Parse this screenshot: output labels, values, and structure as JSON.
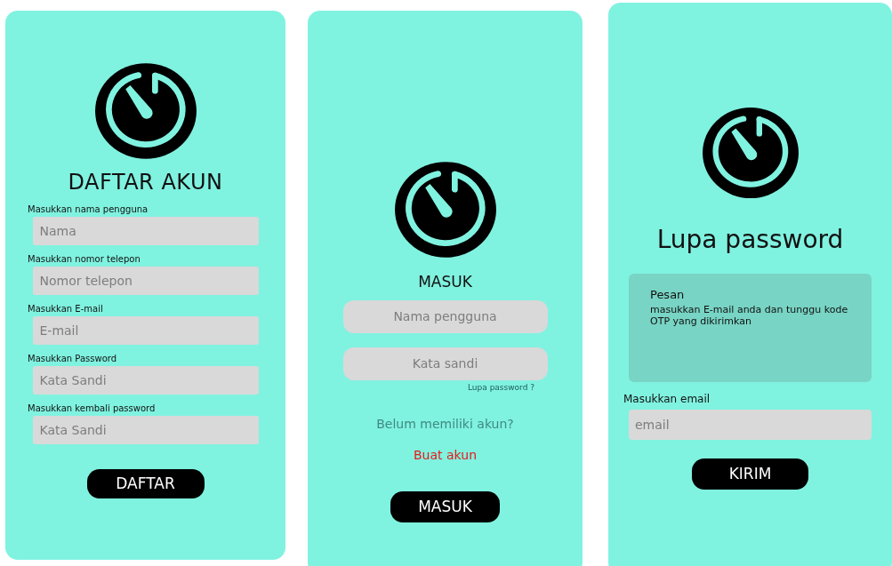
{
  "screens": [
    {
      "kind": "register",
      "items": [
        {
          "kind": "logo"
        },
        {
          "kind": "title",
          "text": "DAFTAR AKUN"
        },
        {
          "kind": "label",
          "text": "Masukkan nama pengguna"
        },
        {
          "kind": "field",
          "placeholder": "Nama"
        },
        {
          "kind": "label",
          "text": "Masukkan nomor telepon"
        },
        {
          "kind": "field",
          "placeholder": "Nomor telepon"
        },
        {
          "kind": "label",
          "text": "Masukkan E-mail"
        },
        {
          "kind": "field",
          "placeholder": "E-mail"
        },
        {
          "kind": "label",
          "text": "Masukkan Password"
        },
        {
          "kind": "field",
          "placeholder": "Kata Sandi"
        },
        {
          "kind": "label",
          "text": "Masukkan kembali password"
        },
        {
          "kind": "field",
          "placeholder": "Kata Sandi"
        },
        {
          "kind": "button",
          "text": "DAFTAR"
        }
      ]
    },
    {
      "kind": "login",
      "items": [
        {
          "kind": "logo"
        },
        {
          "kind": "title",
          "text": "MASUK"
        },
        {
          "kind": "field",
          "placeholder": "Nama pengguna"
        },
        {
          "kind": "field",
          "placeholder": "Kata sandi"
        },
        {
          "kind": "hint-link",
          "text": "Lupa password ?"
        },
        {
          "kind": "note",
          "text": "Belum memiliki akun?"
        },
        {
          "kind": "link",
          "text": "Buat akun"
        },
        {
          "kind": "button",
          "text": "MASUK"
        }
      ]
    },
    {
      "kind": "forgot",
      "items": [
        {
          "kind": "logo"
        },
        {
          "kind": "title",
          "text": "Lupa password"
        },
        {
          "kind": "message",
          "heading": "Pesan",
          "text": "masukkan E-mail anda dan tunggu kode OTP yang dikirimkan"
        },
        {
          "kind": "label",
          "text": "Masukkan email"
        },
        {
          "kind": "field",
          "placeholder": "email"
        },
        {
          "kind": "button",
          "text": "KIRIM"
        }
      ]
    }
  ]
}
